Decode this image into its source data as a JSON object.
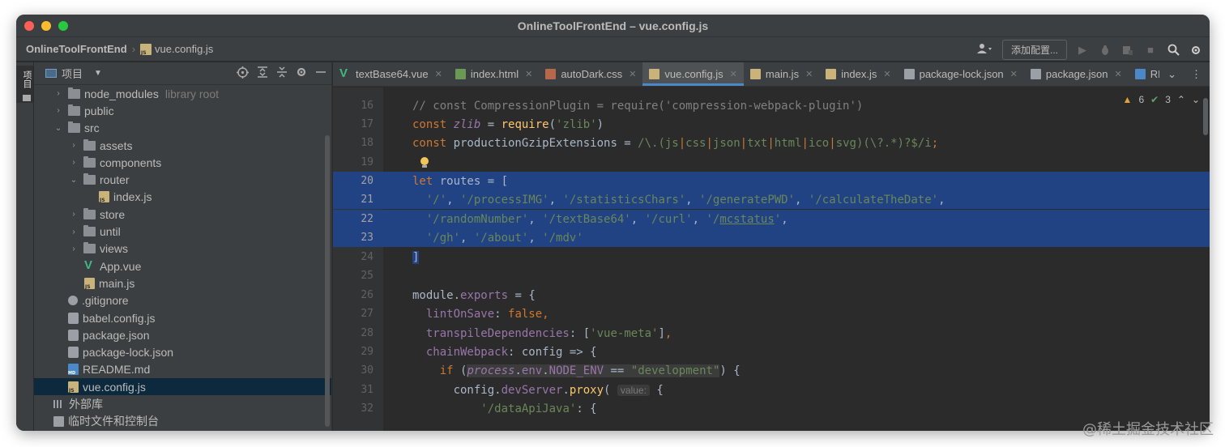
{
  "window": {
    "title": "OnlineToolFrontEnd – vue.config.js"
  },
  "navbar": {
    "project": "OnlineToolFrontEnd",
    "file": "vue.config.js",
    "user_icon": "user-icon",
    "config_label": "添加配置..."
  },
  "toolstrip": {
    "tab_label": "项目"
  },
  "project_panel": {
    "title": "项目",
    "tree": [
      {
        "label": "node_modules",
        "note": "library root",
        "type": "folder",
        "expanded": false
      },
      {
        "label": "public",
        "type": "folder",
        "expanded": false
      },
      {
        "label": "src",
        "type": "folder",
        "expanded": true
      },
      {
        "label": "assets",
        "type": "folder",
        "expanded": false
      },
      {
        "label": "components",
        "type": "folder",
        "expanded": false
      },
      {
        "label": "router",
        "type": "folder",
        "expanded": true
      },
      {
        "label": "index.js",
        "type": "js"
      },
      {
        "label": "store",
        "type": "folder",
        "expanded": false
      },
      {
        "label": "until",
        "type": "folder",
        "expanded": false
      },
      {
        "label": "views",
        "type": "folder",
        "expanded": false
      },
      {
        "label": "App.vue",
        "type": "vue"
      },
      {
        "label": "main.js",
        "type": "js"
      },
      {
        "label": ".gitignore",
        "type": "git"
      },
      {
        "label": "babel.config.js",
        "type": "json"
      },
      {
        "label": "package.json",
        "type": "json"
      },
      {
        "label": "package-lock.json",
        "type": "json"
      },
      {
        "label": "README.md",
        "type": "md"
      },
      {
        "label": "vue.config.js",
        "type": "js",
        "selected": true
      },
      {
        "label": "外部库",
        "type": "lib"
      },
      {
        "label": "临时文件和控制台",
        "type": "scratch"
      }
    ]
  },
  "editor": {
    "tabs": [
      {
        "label": "textBase64.vue",
        "icon": "vue"
      },
      {
        "label": "index.html",
        "icon": "html"
      },
      {
        "label": "autoDark.css",
        "icon": "css"
      },
      {
        "label": "vue.config.js",
        "icon": "js",
        "active": true
      },
      {
        "label": "main.js",
        "icon": "js"
      },
      {
        "label": "index.js",
        "icon": "js"
      },
      {
        "label": "package-lock.json",
        "icon": "json"
      },
      {
        "label": "package.json",
        "icon": "json"
      },
      {
        "label": "READM",
        "icon": "md"
      }
    ],
    "inspections": {
      "warnings": "6",
      "ok": "3"
    },
    "line_numbers": [
      "16",
      "17",
      "18",
      "19",
      "20",
      "21",
      "22",
      "23",
      "24",
      "25",
      "26",
      "27",
      "28",
      "29",
      "30",
      "31",
      "32"
    ],
    "inlay_hint": "value:"
  },
  "colors": {
    "selection": "#214283",
    "keyword": "#cc7832",
    "string": "#6a8759",
    "active_tab_accent": "#4a88c7"
  },
  "watermark": "@稀土掘金技术社区"
}
